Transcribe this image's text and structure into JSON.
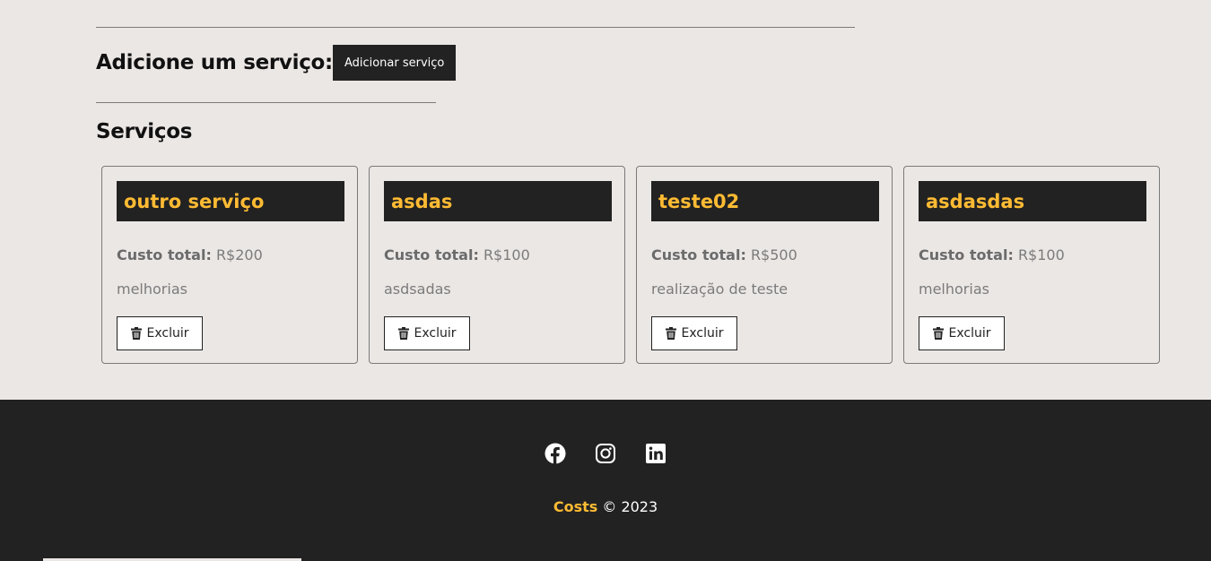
{
  "add_section": {
    "title": "Adicione um serviço:",
    "button_label": "Adicionar serviço"
  },
  "services_section": {
    "title": "Serviços",
    "cost_label": "Custo total:",
    "delete_label": "Excluir",
    "cards": [
      {
        "name": "outro serviço",
        "cost": "R$200",
        "description": "melhorias"
      },
      {
        "name": "asdas",
        "cost": "R$100",
        "description": "asdsadas"
      },
      {
        "name": "teste02",
        "cost": "R$500",
        "description": "realização de teste"
      },
      {
        "name": "asdasdas",
        "cost": "R$100",
        "description": "melhorias"
      }
    ]
  },
  "footer": {
    "social_icons": [
      "facebook-icon",
      "instagram-icon",
      "linkedin-icon"
    ],
    "brand": "Costs",
    "copyright": "© 2023"
  },
  "colors": {
    "background": "#ebe7e5",
    "dark": "#222222",
    "accent": "#ffbb33"
  }
}
